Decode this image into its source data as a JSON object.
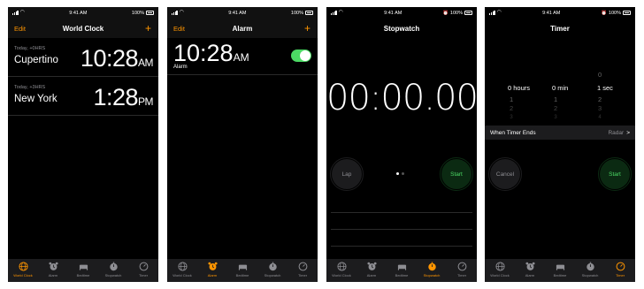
{
  "status": {
    "time": "9:41 AM",
    "battery": "100%"
  },
  "tabs": [
    "World Clock",
    "Alarm",
    "Bedtime",
    "Stopwatch",
    "Timer"
  ],
  "icons": {
    "tab_icons": [
      "globe-icon",
      "alarm-clock-icon",
      "bed-icon",
      "stopwatch-icon",
      "timer-icon"
    ],
    "chevron": "chevron-right-icon"
  },
  "colors": {
    "accent": "#ff9500",
    "green": "#4cd964",
    "background": "#000000",
    "bar": "#1c1c1e",
    "secondary_text": "#8e8e93"
  },
  "world_clock": {
    "edit_label": "Edit",
    "title": "World Clock",
    "add_label": "+",
    "rows": [
      {
        "offset": "Today, +0HRS",
        "city": "Cupertino",
        "time": "10:28",
        "ampm": "AM"
      },
      {
        "offset": "Today, +3HRS",
        "city": "New York",
        "time": "1:28",
        "ampm": "PM"
      }
    ]
  },
  "alarm": {
    "edit_label": "Edit",
    "title": "Alarm",
    "add_label": "+",
    "item": {
      "time": "10:28",
      "ampm": "AM",
      "label": "Alarm",
      "enabled": true
    }
  },
  "stopwatch": {
    "title": "Stopwatch",
    "display": "00:00.00",
    "lap_label": "Lap",
    "start_label": "Start"
  },
  "timer": {
    "title": "Timer",
    "picker": {
      "above": {
        "sec": "0"
      },
      "hours": {
        "value": "0",
        "unit": "hours",
        "below": [
          "1",
          "2",
          "3"
        ]
      },
      "min": {
        "value": "0",
        "unit": "min",
        "below": [
          "1",
          "2",
          "3"
        ]
      },
      "sec": {
        "value": "1",
        "unit": "sec",
        "below": [
          "2",
          "3",
          "4"
        ]
      }
    },
    "when_ends_label": "When Timer Ends",
    "when_ends_value": "Radar",
    "chevron": ">",
    "cancel_label": "Cancel",
    "start_label": "Start"
  }
}
